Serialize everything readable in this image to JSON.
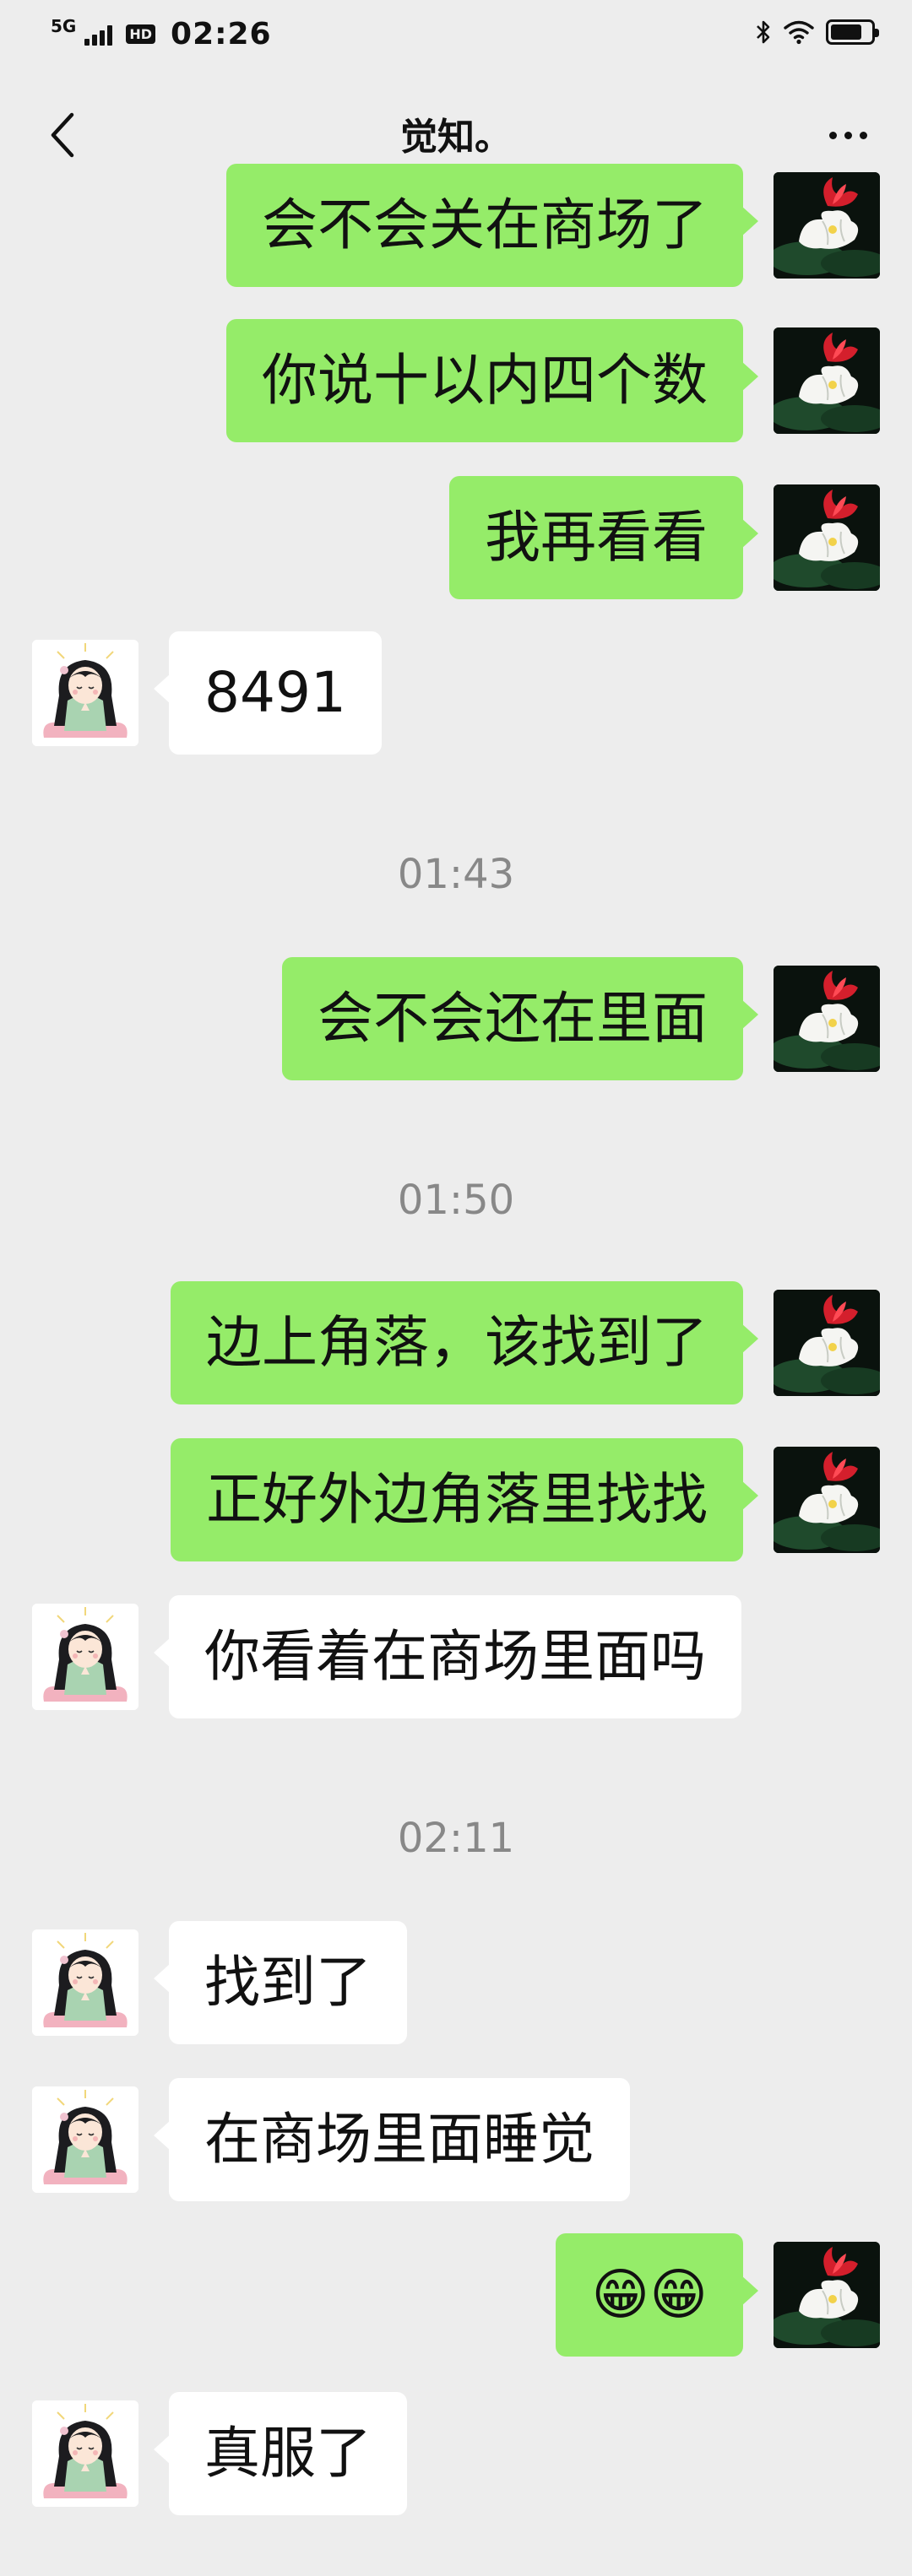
{
  "status_bar": {
    "network": "5G",
    "hd": "HD",
    "time": "02:26"
  },
  "nav": {
    "title": "觉知。",
    "back_icon": "chevron-left-icon",
    "more_icon": "more-dots-icon"
  },
  "colors": {
    "background": "#ededed",
    "sent_bubble": "#95ec69",
    "received_bubble": "#ffffff"
  },
  "messages": [
    {
      "sender": "me",
      "text": "会不会关在商场了"
    },
    {
      "sender": "me",
      "text": "你说十以内四个数"
    },
    {
      "sender": "me",
      "text": "我再看看"
    },
    {
      "sender": "her",
      "text": "8491"
    },
    {
      "type": "time",
      "text": "01:43"
    },
    {
      "sender": "me",
      "text": "会不会还在里面"
    },
    {
      "type": "time",
      "text": "01:50"
    },
    {
      "sender": "me",
      "text": "边上角落，该找到了"
    },
    {
      "sender": "me",
      "text": "正好外边角落里找找"
    },
    {
      "sender": "her",
      "text": "你看着在商场里面吗"
    },
    {
      "type": "time",
      "text": "02:11"
    },
    {
      "sender": "her",
      "text": "找到了"
    },
    {
      "sender": "her",
      "text": "在商场里面睡觉"
    },
    {
      "sender": "me",
      "text": "😁😁"
    },
    {
      "sender": "her",
      "text": "真服了"
    }
  ]
}
